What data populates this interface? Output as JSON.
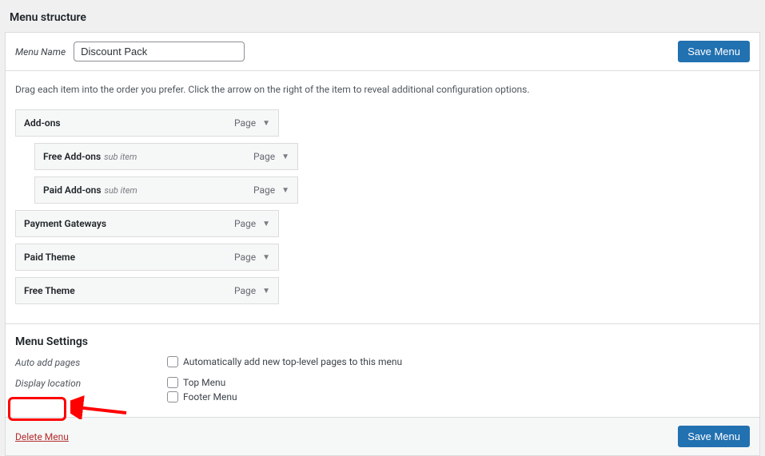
{
  "header": {
    "title": "Menu structure",
    "name_label": "Menu Name",
    "name_value": "Discount Pack",
    "save_label": "Save Menu"
  },
  "instructions": "Drag each item into the order you prefer. Click the arrow on the right of the item to reveal additional configuration options.",
  "items": [
    {
      "title": "Add-ons",
      "type": "Page",
      "sub": false,
      "sub_label": ""
    },
    {
      "title": "Free Add-ons",
      "type": "Page",
      "sub": true,
      "sub_label": "sub item"
    },
    {
      "title": "Paid Add-ons",
      "type": "Page",
      "sub": true,
      "sub_label": "sub item"
    },
    {
      "title": "Payment Gateways",
      "type": "Page",
      "sub": false,
      "sub_label": ""
    },
    {
      "title": "Paid Theme",
      "type": "Page",
      "sub": false,
      "sub_label": ""
    },
    {
      "title": "Free Theme",
      "type": "Page",
      "sub": false,
      "sub_label": ""
    }
  ],
  "settings": {
    "title": "Menu Settings",
    "auto_add_label": "Auto add pages",
    "auto_add_option": "Automatically add new top-level pages to this menu",
    "display_location_label": "Display location",
    "location_top": "Top Menu",
    "location_footer": "Footer Menu"
  },
  "footer": {
    "delete_label": "Delete Menu",
    "save_label": "Save Menu"
  }
}
